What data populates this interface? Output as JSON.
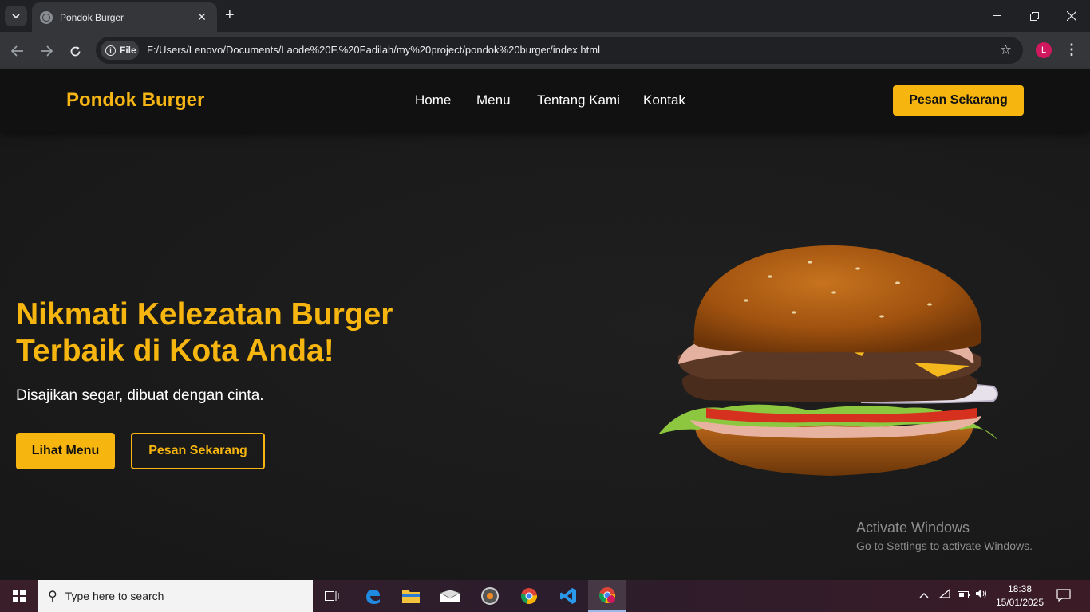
{
  "browser": {
    "tab_title": "Pondok Burger",
    "new_tab": "+",
    "chip_label": "File",
    "url": "F:/Users/Lenovo/Documents/Laode%20F.%20Fadilah/my%20project/pondok%20burger/index.html",
    "profile_initial": "L"
  },
  "site": {
    "brand": "Pondok Burger",
    "nav": [
      "Home",
      "Menu",
      "Tentang Kami",
      "Kontak"
    ],
    "nav_cta": "Pesan Sekarang",
    "hero": {
      "title": "Nikmati Kelezatan Burger Terbaik di Kota Anda!",
      "subtitle": "Disajikan segar, dibuat dengan cinta.",
      "primary_button": "Lihat Menu",
      "secondary_button": "Pesan Sekarang"
    },
    "accent_color": "#f7b50f"
  },
  "watermark": {
    "line1": "Activate Windows",
    "line2": "Go to Settings to activate Windows."
  },
  "taskbar": {
    "search_placeholder": "Type here to search",
    "time": "18:38",
    "date": "15/01/2025"
  }
}
